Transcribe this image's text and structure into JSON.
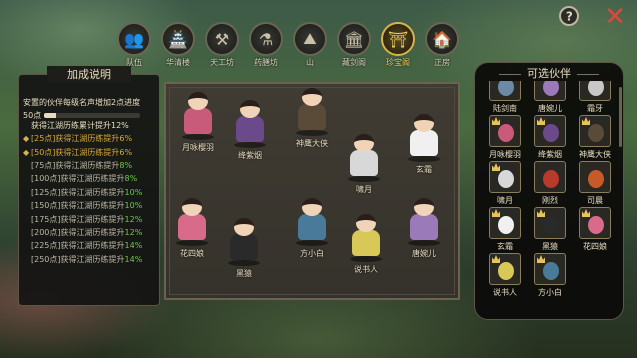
{
  "tabs": [
    {
      "label": "队伍",
      "icon": "team-icon",
      "glyph": "👥"
    },
    {
      "label": "华清楼",
      "icon": "building-icon",
      "glyph": "🏯"
    },
    {
      "label": "天工坊",
      "icon": "workshop-icon",
      "glyph": "⚒"
    },
    {
      "label": "药膳坊",
      "icon": "cauldron-icon",
      "glyph": "⚗"
    },
    {
      "label": "山",
      "icon": "mountain-icon",
      "glyph": "⛰"
    },
    {
      "label": "藏剑阁",
      "icon": "pavilion-icon",
      "glyph": "🏛"
    },
    {
      "label": "珍宝阁",
      "icon": "treasure-pavilion-icon",
      "glyph": "⛩"
    },
    {
      "label": "正房",
      "icon": "house-icon",
      "glyph": "🏠"
    }
  ],
  "active_tab": "珍宝阁",
  "help_label": "?",
  "close_label": "✕",
  "left_panel": {
    "title": "加成说明",
    "description": "安置的伙伴每级名声增加2点进度",
    "progress_label": "50点",
    "progress_fraction": 0.12,
    "current_bonus": "获得江湖历练累计提升12%",
    "levels": [
      {
        "text": "[25点]获得江湖历练提升",
        "pct": "6%",
        "done": true
      },
      {
        "text": "[50点]获得江湖历练提升",
        "pct": "6%",
        "done": true
      },
      {
        "text": "[75点]获得江湖历练提升",
        "pct": "8%",
        "done": false
      },
      {
        "text": "[100点]获得江湖历练提升",
        "pct": "8%",
        "done": false
      },
      {
        "text": "[125点]获得江湖历练提升",
        "pct": "10%",
        "done": false
      },
      {
        "text": "[150点]获得江湖历练提升",
        "pct": "10%",
        "done": false
      },
      {
        "text": "[175点]获得江湖历练提升",
        "pct": "12%",
        "done": false
      },
      {
        "text": "[200点]获得江湖历练提升",
        "pct": "12%",
        "done": false
      },
      {
        "text": "[225点]获得江湖历练提升",
        "pct": "14%",
        "done": false
      },
      {
        "text": "[250点]获得江湖历练提升",
        "pct": "14%",
        "done": false
      }
    ]
  },
  "stage_heroes": [
    {
      "name": "月咏樱羽",
      "color": "#c85a7a"
    },
    {
      "name": "绛紫烟",
      "color": "#6a4a8a"
    },
    {
      "name": "神鹰大侠",
      "color": "#5a4a38"
    },
    {
      "name": "啸月",
      "color": "#d8d8d8"
    },
    {
      "name": "玄霜",
      "color": "#f0f0f0"
    },
    {
      "name": "花四娘",
      "color": "#d86a8a"
    },
    {
      "name": "黑猿",
      "color": "#2a2a2a"
    },
    {
      "name": "方小白",
      "color": "#4a7a9a"
    },
    {
      "name": "说书人",
      "color": "#d8c858"
    },
    {
      "name": "唐婉儿",
      "color": "#9a7ab8"
    }
  ],
  "right_panel": {
    "title": "可选伙伴",
    "partners": [
      {
        "name": "陆剑南",
        "color": "#6a8aa8",
        "crown": false
      },
      {
        "name": "唐婉儿",
        "color": "#9a7ab8",
        "crown": false
      },
      {
        "name": "霜牙",
        "color": "#c8c8c8",
        "crown": false
      },
      {
        "name": "月咏樱羽",
        "color": "#c85a7a",
        "crown": true
      },
      {
        "name": "绛紫烟",
        "color": "#6a4a8a",
        "crown": true
      },
      {
        "name": "神鹰大侠",
        "color": "#5a4a38",
        "crown": true
      },
      {
        "name": "啸月",
        "color": "#d8d8d8",
        "crown": true
      },
      {
        "name": "刚烈",
        "color": "#b83a2a",
        "crown": false
      },
      {
        "name": "司晨",
        "color": "#c85a2a",
        "crown": false
      },
      {
        "name": "玄霜",
        "color": "#f0f0f0",
        "crown": true
      },
      {
        "name": "黑猿",
        "color": "#2a2a2a",
        "crown": true
      },
      {
        "name": "花四娘",
        "color": "#d86a8a",
        "crown": true
      },
      {
        "name": "说书人",
        "color": "#d8c858",
        "crown": true
      },
      {
        "name": "方小白",
        "color": "#4a7a9a",
        "crown": true
      }
    ]
  }
}
